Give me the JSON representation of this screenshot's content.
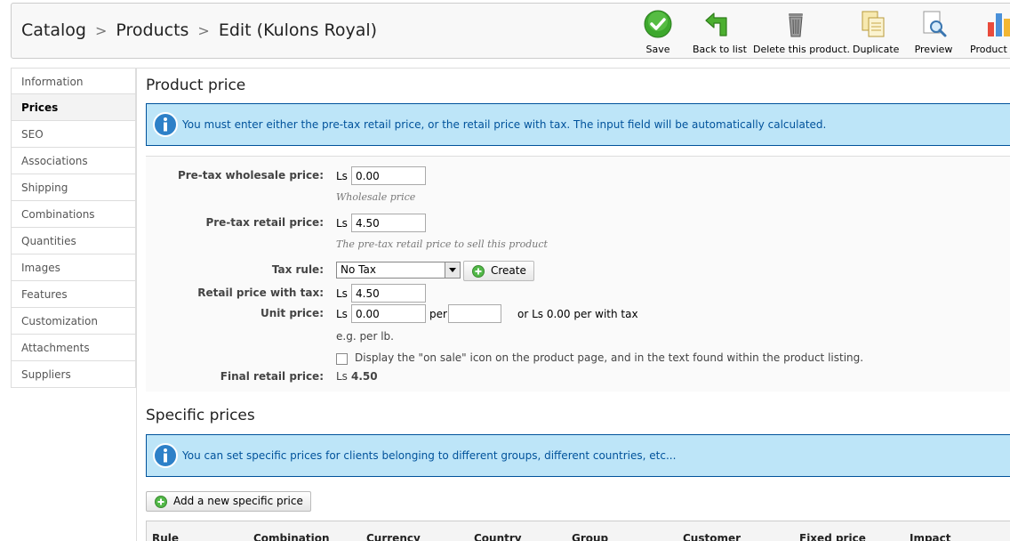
{
  "header": {
    "breadcrumb": [
      "Catalog",
      "Products",
      "Edit (Kulons Royal)"
    ],
    "separator": ">",
    "toolbar": {
      "save": "Save",
      "back": "Back to list",
      "delete": "Delete this product.",
      "duplicate": "Duplicate",
      "preview": "Preview",
      "stats": "Product s"
    }
  },
  "sidebar": {
    "items": [
      "Information",
      "Prices",
      "SEO",
      "Associations",
      "Shipping",
      "Combinations",
      "Quantities",
      "Images",
      "Features",
      "Customization",
      "Attachments",
      "Suppliers"
    ],
    "active": "Prices"
  },
  "product_price": {
    "title": "Product price",
    "info": "You must enter either the pre-tax retail price, or the retail price with tax. The input field will be automatically calculated.",
    "currency": "Ls",
    "wholesale_label": "Pre-tax wholesale price:",
    "wholesale_value": "0.00",
    "wholesale_hint": "Wholesale price",
    "retail_label": "Pre-tax retail price:",
    "retail_value": "4.50",
    "retail_hint": "The pre-tax retail price to sell this product",
    "tax_label": "Tax rule:",
    "tax_value": "No Tax",
    "create_button": "Create",
    "with_tax_label": "Retail price with tax:",
    "with_tax_value": "4.50",
    "unit_label": "Unit price:",
    "unit_value": "0.00",
    "per_label": "per",
    "unit_per_value": "",
    "unit_tax_text": "or Ls 0.00 per with tax",
    "unit_hint": "e.g. per lb.",
    "on_sale_text": "Display the \"on sale\" icon on the product page, and in the text found within the product listing.",
    "final_label": "Final retail price:",
    "final_currency": "Ls",
    "final_value": "4.50"
  },
  "specific_prices": {
    "title": "Specific prices",
    "info": "You can set specific prices for clients belonging to different groups, different countries, etc...",
    "add_button": "Add a new specific price",
    "columns": [
      "Rule",
      "Combination",
      "Currency",
      "Country",
      "Group",
      "Customer",
      "Fixed price",
      "Impact"
    ]
  },
  "colors": {
    "info_bg": "#bde5f8",
    "info_text": "#00529b",
    "save_green": "#3da82d"
  }
}
